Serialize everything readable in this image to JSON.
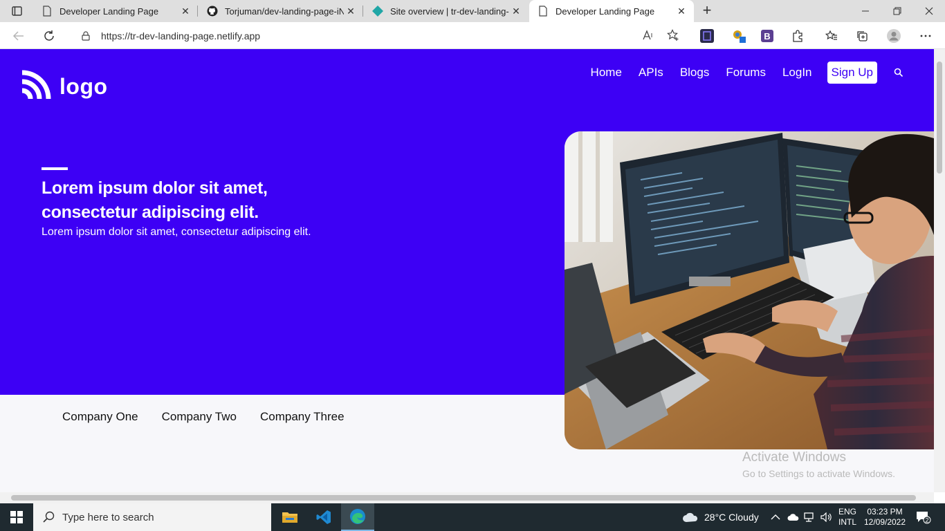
{
  "browser": {
    "tabs": [
      {
        "title": "Developer Landing Page",
        "icon": "page-icon",
        "active": false
      },
      {
        "title": "Torjuman/dev-landing-page-iNe",
        "icon": "github-icon",
        "active": false
      },
      {
        "title": "Site overview | tr-dev-landing-pa",
        "icon": "netlify-icon",
        "active": false
      },
      {
        "title": "Developer Landing Page",
        "icon": "page-icon",
        "active": true
      }
    ],
    "new_tab_label": "+",
    "url": "https://tr-dev-landing-page.netlify.app",
    "extension_badge": "B"
  },
  "site": {
    "logo_text": "logo",
    "nav": {
      "home": "Home",
      "apis": "APIs",
      "blogs": "Blogs",
      "forums": "Forums",
      "login": "LogIn",
      "signup": "Sign Up"
    },
    "hero": {
      "title": "Lorem ipsum dolor sit amet, consectetur adipiscing elit.",
      "subtitle": "Lorem ipsum dolor sit amet, consectetur adipiscing elit."
    },
    "companies": [
      "Company One",
      "Company Two",
      "Company Three"
    ],
    "colors": {
      "brand": "#3d00f5",
      "background": "#f7f7fa"
    }
  },
  "watermark": {
    "line1": "Activate Windows",
    "line2": "Go to Settings to activate Windows."
  },
  "taskbar": {
    "search_placeholder": "Type here to search",
    "weather": "28°C  Cloudy",
    "lang_top": "ENG",
    "lang_bottom": "INTL",
    "time": "03:23 PM",
    "date": "12/09/2022",
    "notification_count": "2"
  }
}
